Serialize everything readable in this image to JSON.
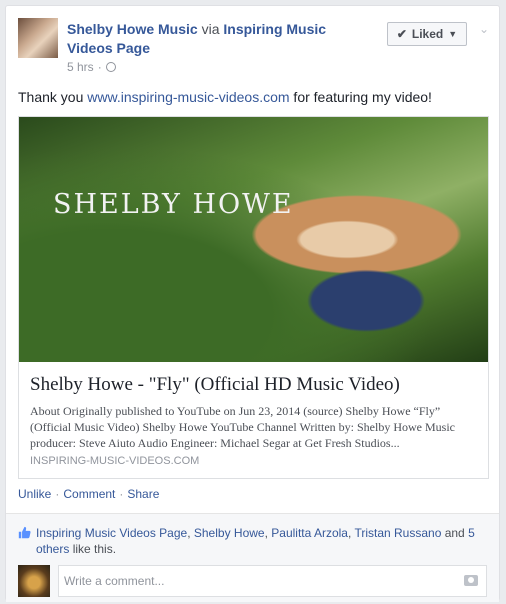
{
  "post": {
    "author": "Shelby Howe Music",
    "via": "via",
    "page": "Inspiring Music Videos Page",
    "time": "5 hrs",
    "liked_label": "Liked",
    "status_pre": "Thank you ",
    "status_link": "www.inspiring-music-videos.com",
    "status_post": " for featuring my video!"
  },
  "link_card": {
    "thumb_text": "SHELBY HOWE",
    "title": "Shelby Howe - \"Fly\" (Official HD Music Video)",
    "description": "About Originally published to YouTube on Jun 23, 2014 (source) Shelby Howe “Fly” (Official Music Video) Shelby Howe YouTube Channel Written by: Shelby Howe Music producer: Steve Aiuto Audio Engineer: Michael Segar at Get Fresh Studios...",
    "domain": "INSPIRING-MUSIC-VIDEOS.COM"
  },
  "actions": {
    "unlike": "Unlike",
    "comment": "Comment",
    "share": "Share",
    "sep": "·"
  },
  "likes": {
    "names": [
      "Inspiring Music Videos Page",
      "Shelby Howe",
      "Paulitta Arzola",
      "Tristan Russano"
    ],
    "and": " and ",
    "others": "5 others",
    "suffix": " like this."
  },
  "comment": {
    "placeholder": "Write a comment..."
  },
  "colors": {
    "link": "#365899",
    "background": "#e9ebee"
  }
}
